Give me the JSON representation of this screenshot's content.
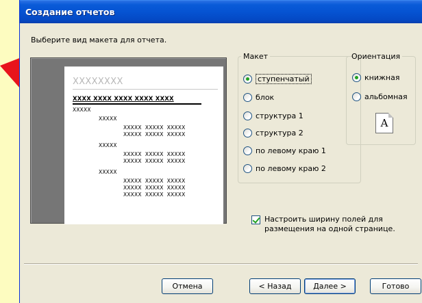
{
  "window": {
    "title": "Создание отчетов"
  },
  "instruction": "Выберите вид макета для отчета.",
  "preview": {
    "title": "XXXXXXXX",
    "header": "XXXX  XXXX  XXXX  XXXX  XXXX",
    "rows": [
      "XXXXX",
      "XXXXX",
      "XXXXX  XXXXX  XXXXX",
      "XXXXX  XXXXX  XXXXX",
      "XXXXX",
      "XXXXX  XXXXX  XXXXX",
      "XXXXX  XXXXX  XXXXX",
      "XXXXX",
      "XXXXX  XXXXX  XXXXX",
      "XXXXX  XXXXX  XXXXX",
      "XXXXX  XXXXX  XXXXX"
    ]
  },
  "layout": {
    "legend": "Макет",
    "selected": "ступенчатый",
    "options": [
      "ступенчатый",
      "блок",
      "структура 1",
      "структура 2",
      "по левому краю 1",
      "по левому краю 2"
    ]
  },
  "orientation": {
    "legend": "Ориентация",
    "selected": "книжная",
    "options": [
      "книжная",
      "альбомная"
    ],
    "page_icon_letter": "A"
  },
  "fit_width": {
    "checked": true,
    "label_line1": "Настроить ширину полей для",
    "label_line2": "размещения на одной странице."
  },
  "buttons": {
    "cancel": "Отмена",
    "back": "< Назад",
    "next": "Далее >",
    "finish": "Готово"
  },
  "colors": {
    "background": "#fdfcc0",
    "arrow": "#e8141c",
    "titlebar": "#0553d2",
    "dialog": "#ece9d8"
  }
}
